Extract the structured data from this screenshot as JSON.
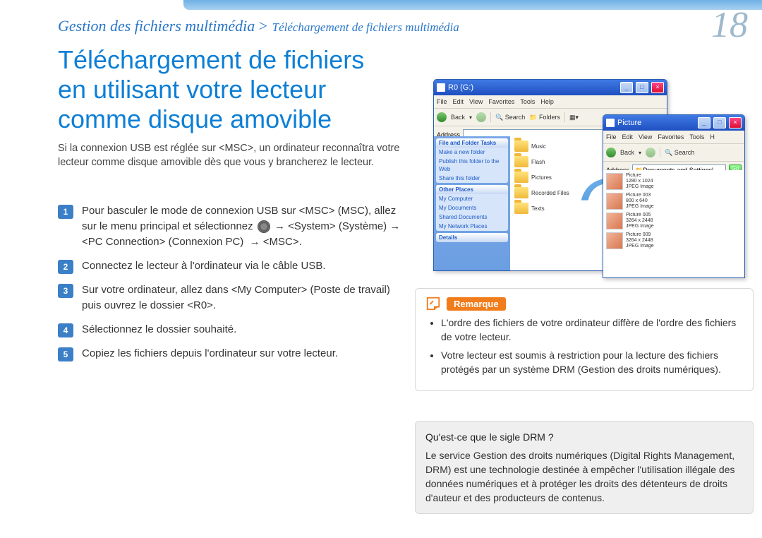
{
  "page_number": "18",
  "breadcrumb": {
    "main": "Gestion des fichiers multimédia",
    "sep": " > ",
    "sub": "Téléchargement de fichiers multimédia"
  },
  "title": "Téléchargement de fichiers en utilisant votre lecteur comme disque amovible",
  "intro": "Si la connexion USB est réglée sur <MSC>, un ordinateur reconnaîtra votre lecteur comme disque amovible dès que vous y brancherez le lecteur.",
  "steps": [
    "Pour basculer le mode de connexion USB sur <MSC> (MSC), allez sur le menu principal et sélectionnez ⚙ → <System> (Système) → <PC Connection> (Connexion PC)  → <MSC>.",
    "Connectez le lecteur à l'ordinateur via le câble USB.",
    "Sur votre ordinateur, allez dans <My Computer> (Poste de travail) puis ouvrez le dossier <R0>.",
    "Sélectionnez le dossier souhaité.",
    "Copiez les fichiers depuis l'ordinateur sur votre lecteur."
  ],
  "windows": {
    "main": {
      "title": "R0 (G:)",
      "menu": [
        "File",
        "Edit",
        "View",
        "Favorites",
        "Tools",
        "Help"
      ],
      "toolbar": {
        "back": "Back",
        "search": "Search",
        "folders": "Folders"
      },
      "address_label": "Address",
      "sidepanel": {
        "tasks": {
          "head": "File and Folder Tasks",
          "items": [
            "Make a new folder",
            "Publish this folder to the Web",
            "Share this folder"
          ]
        },
        "places": {
          "head": "Other Places",
          "items": [
            "My Computer",
            "My Documents",
            "Shared Documents",
            "My Network Places"
          ]
        },
        "details_head": "Details"
      },
      "folders": [
        "Music",
        "Flash",
        "Pictures",
        "Recorded Files",
        "Texts"
      ]
    },
    "sub": {
      "title": "Picture",
      "menu": [
        "File",
        "Edit",
        "View",
        "Favorites",
        "Tools",
        "H"
      ],
      "toolbar_back": "Back",
      "toolbar_search": "Search",
      "address_label": "Address",
      "address_value": "Documents and Settings\\",
      "go": "Go",
      "thumbs": [
        {
          "name": "Picture",
          "meta1": "1280 x 1024",
          "meta2": "JPEG Image"
        },
        {
          "name": "Picture 003",
          "meta1": "800 x 640",
          "meta2": "JPEG Image"
        },
        {
          "name": "Picture 005",
          "meta1": "3264 x 2448",
          "meta2": "JPEG Image"
        },
        {
          "name": "Picture 009",
          "meta1": "3264 x 2448",
          "meta2": "JPEG Image"
        }
      ]
    }
  },
  "remarque": {
    "label": "Remarque",
    "items": [
      "L'ordre des fichiers de votre ordinateur diffère de l'ordre des fichiers de votre lecteur.",
      "Votre lecteur est soumis à restriction pour la lecture des fichiers protégés par un système DRM (Gestion des droits numériques)."
    ]
  },
  "drm": {
    "question": "Qu'est-ce que le sigle DRM ?",
    "answer": "Le service Gestion des droits numériques (Digital Rights Management, DRM) est une technologie destinée à empêcher l'utilisation illégale des données numériques et à protéger les droits des détenteurs de droits d'auteur et des producteurs de contenus."
  }
}
